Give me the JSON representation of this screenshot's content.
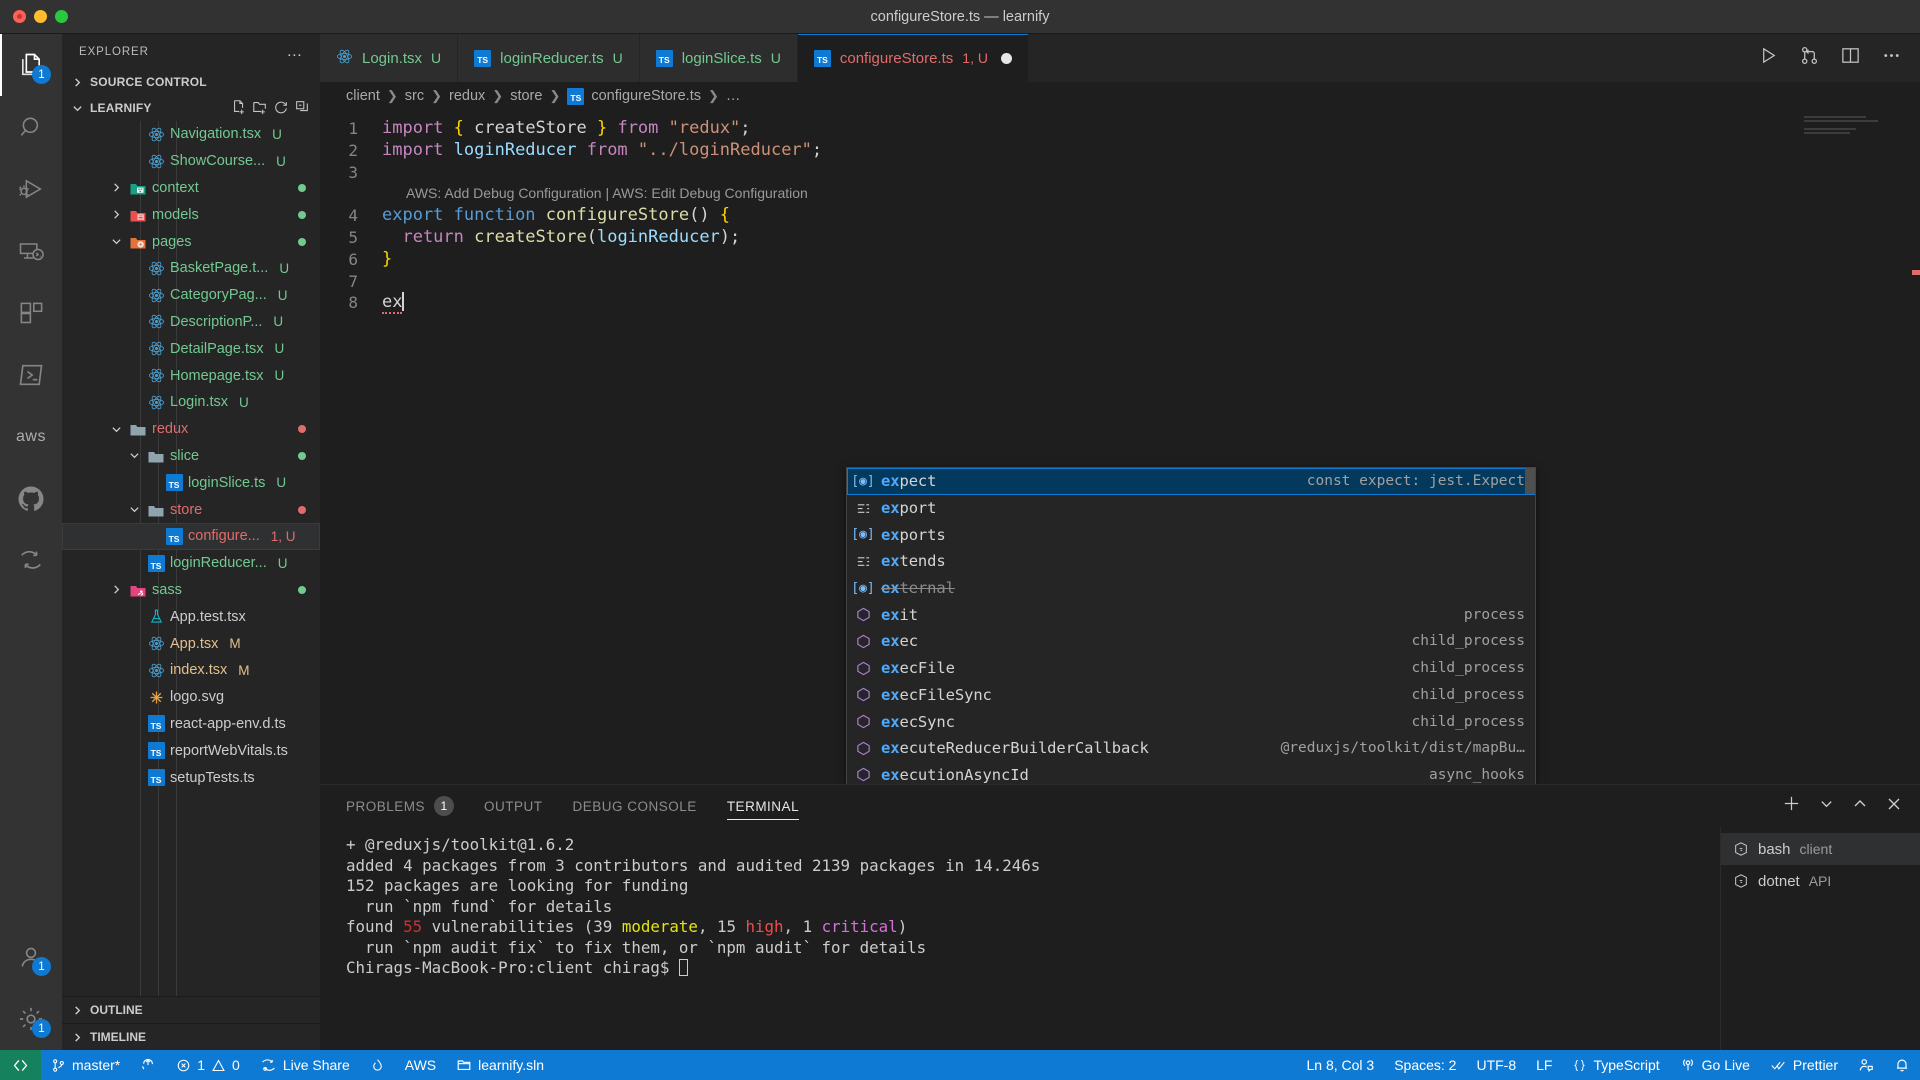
{
  "window": {
    "title": "configureStore.ts — learnify"
  },
  "activity_bar": {
    "items": [
      {
        "name": "explorer",
        "icon": "files-icon",
        "badge": "1",
        "active": true
      },
      {
        "name": "search",
        "icon": "search-icon",
        "badge": "",
        "active": false
      },
      {
        "name": "run-and-debug",
        "icon": "debug-icon",
        "badge": "",
        "active": false
      },
      {
        "name": "remote-explorer",
        "icon": "remote-icon",
        "badge": "",
        "active": false
      },
      {
        "name": "extensions",
        "icon": "extensions-icon",
        "badge": "",
        "active": false
      },
      {
        "name": "powershell",
        "icon": "terminal-icon",
        "badge": "",
        "active": false
      },
      {
        "name": "aws-toolkit",
        "icon": "aws-icon",
        "label": "aws",
        "badge": "",
        "active": false
      },
      {
        "name": "github",
        "icon": "github-icon",
        "badge": "",
        "active": false
      },
      {
        "name": "live-share",
        "icon": "live-share-icon",
        "badge": "",
        "active": false
      }
    ],
    "bottom": [
      {
        "name": "accounts",
        "icon": "account-icon",
        "badge": "1"
      },
      {
        "name": "settings",
        "icon": "gear-icon",
        "badge": "1"
      }
    ]
  },
  "sidebar": {
    "header": "EXPLORER",
    "more_actions": "…",
    "sections": [
      {
        "label": "SOURCE CONTROL",
        "expanded": false
      },
      {
        "label": "LEARNIFY",
        "expanded": true
      }
    ],
    "section_actions": [
      "new-file-icon",
      "new-folder-icon",
      "refresh-icon",
      "collapse-all-icon"
    ],
    "tree": [
      {
        "indent": 3,
        "icon": "react",
        "name": "Navigation.tsx",
        "badge": "U",
        "badge_kind": "u",
        "type": "file"
      },
      {
        "indent": 3,
        "icon": "react",
        "name": "ShowCourse...",
        "badge": "U",
        "badge_kind": "u",
        "type": "file"
      },
      {
        "indent": 2,
        "icon": "folder-context",
        "name": "context",
        "arrow": "right",
        "dot": "#73c991",
        "type": "folder"
      },
      {
        "indent": 2,
        "icon": "folder-models",
        "name": "models",
        "arrow": "right",
        "dot": "#73c991",
        "type": "folder"
      },
      {
        "indent": 2,
        "icon": "folder-pages",
        "name": "pages",
        "arrow": "down",
        "dot": "#73c991",
        "type": "folder"
      },
      {
        "indent": 3,
        "icon": "react",
        "name": "BasketPage.t...",
        "badge": "U",
        "badge_kind": "u",
        "type": "file"
      },
      {
        "indent": 3,
        "icon": "react",
        "name": "CategoryPag...",
        "badge": "U",
        "badge_kind": "u",
        "type": "file"
      },
      {
        "indent": 3,
        "icon": "react",
        "name": "DescriptionP...",
        "badge": "U",
        "badge_kind": "u",
        "type": "file"
      },
      {
        "indent": 3,
        "icon": "react",
        "name": "DetailPage.tsx",
        "badge": "U",
        "badge_kind": "u",
        "type": "file"
      },
      {
        "indent": 3,
        "icon": "react",
        "name": "Homepage.tsx",
        "badge": "U",
        "badge_kind": "u",
        "type": "file"
      },
      {
        "indent": 3,
        "icon": "react",
        "name": "Login.tsx",
        "badge": "U",
        "badge_kind": "u",
        "type": "file"
      },
      {
        "indent": 2,
        "icon": "folder",
        "name": "redux",
        "arrow": "down",
        "dot": "#e06c6c",
        "type": "folder",
        "color": "#e06c6c"
      },
      {
        "indent": 3,
        "icon": "folder",
        "name": "slice",
        "arrow": "down",
        "dot": "#73c991",
        "type": "folder"
      },
      {
        "indent": 4,
        "icon": "ts",
        "name": "loginSlice.ts",
        "badge": "U",
        "badge_kind": "u",
        "type": "file"
      },
      {
        "indent": 3,
        "icon": "folder",
        "name": "store",
        "arrow": "down",
        "dot": "#e06c6c",
        "type": "folder",
        "color": "#e06c6c"
      },
      {
        "indent": 4,
        "icon": "ts",
        "name": "configure...",
        "badge": "1, U",
        "badge_kind": "err",
        "type": "file",
        "color": "#e06c6c",
        "selected": true
      },
      {
        "indent": 3,
        "icon": "ts",
        "name": "loginReducer...",
        "badge": "U",
        "badge_kind": "u",
        "type": "file"
      },
      {
        "indent": 2,
        "icon": "folder-sass",
        "name": "sass",
        "arrow": "right",
        "dot": "#73c991",
        "type": "folder"
      },
      {
        "indent": 3,
        "icon": "test",
        "name": "App.test.tsx",
        "badge": "",
        "type": "file",
        "color": "#cccccc"
      },
      {
        "indent": 3,
        "icon": "react",
        "name": "App.tsx",
        "badge": "M",
        "badge_kind": "m",
        "type": "file",
        "color": "#e2c08d"
      },
      {
        "indent": 3,
        "icon": "react",
        "name": "index.tsx",
        "badge": "M",
        "badge_kind": "m",
        "type": "file",
        "color": "#e2c08d"
      },
      {
        "indent": 3,
        "icon": "svg",
        "name": "logo.svg",
        "badge": "",
        "type": "file",
        "color": "#cccccc"
      },
      {
        "indent": 3,
        "icon": "ts",
        "name": "react-app-env.d.ts",
        "badge": "",
        "type": "file",
        "color": "#cccccc"
      },
      {
        "indent": 3,
        "icon": "ts",
        "name": "reportWebVitals.ts",
        "badge": "",
        "type": "file",
        "color": "#cccccc"
      },
      {
        "indent": 3,
        "icon": "ts",
        "name": "setupTests.ts",
        "badge": "",
        "type": "file",
        "color": "#cccccc"
      }
    ],
    "bottom_sections": [
      {
        "label": "OUTLINE",
        "expanded": false
      },
      {
        "label": "TIMELINE",
        "expanded": false
      }
    ]
  },
  "tabs": [
    {
      "label": "Login.tsx",
      "suffix": "U",
      "icon": "react",
      "active": false,
      "dirty": false
    },
    {
      "label": "loginReducer.ts",
      "suffix": "U",
      "icon": "ts",
      "active": false,
      "dirty": false
    },
    {
      "label": "loginSlice.ts",
      "suffix": "U",
      "icon": "ts",
      "active": false,
      "dirty": false
    },
    {
      "label": "configureStore.ts",
      "suffix": "1, U",
      "icon": "ts",
      "active": true,
      "dirty": true
    }
  ],
  "editor_actions": [
    "run-icon",
    "source-control-icon",
    "split-editor-icon",
    "more-actions-icon"
  ],
  "breadcrumb": {
    "parts": [
      "client",
      "src",
      "redux",
      "store"
    ],
    "file": "configureStore.ts",
    "trailing": "…",
    "file_icon": "ts"
  },
  "code": {
    "lines": [
      {
        "num": "1",
        "tokens": [
          {
            "t": "import ",
            "c": "k-purple"
          },
          {
            "t": "{ ",
            "c": "k-brace-y"
          },
          {
            "t": "createStore",
            "c": "k-plain"
          },
          {
            "t": " }",
            "c": "k-brace-y"
          },
          {
            "t": " from ",
            "c": "k-purple"
          },
          {
            "t": "\"redux\"",
            "c": "k-str"
          },
          {
            "t": ";",
            "c": "k-plain"
          }
        ]
      },
      {
        "num": "2",
        "tokens": [
          {
            "t": "import ",
            "c": "k-purple"
          },
          {
            "t": "loginReducer",
            "c": "k-var"
          },
          {
            "t": " from ",
            "c": "k-purple"
          },
          {
            "t": "\"../loginReducer\"",
            "c": "k-str"
          },
          {
            "t": ";",
            "c": "k-plain"
          }
        ]
      },
      {
        "num": "3",
        "tokens": []
      },
      {
        "num": "4",
        "tokens": [
          {
            "t": "export ",
            "c": "k-blue"
          },
          {
            "t": "function ",
            "c": "k-blue"
          },
          {
            "t": "configureStore",
            "c": "k-fn"
          },
          {
            "t": "()",
            "c": "k-plain"
          },
          {
            "t": " {",
            "c": "k-brace-y"
          }
        ]
      },
      {
        "num": "5",
        "tokens": [
          {
            "t": "  return ",
            "c": "k-purple"
          },
          {
            "t": "createStore",
            "c": "k-fn"
          },
          {
            "t": "(",
            "c": "k-plain"
          },
          {
            "t": "loginReducer",
            "c": "k-var"
          },
          {
            "t": ");",
            "c": "k-plain"
          }
        ]
      },
      {
        "num": "6",
        "tokens": [
          {
            "t": "}",
            "c": "k-brace-y"
          }
        ]
      },
      {
        "num": "7",
        "tokens": []
      },
      {
        "num": "8",
        "tokens": [
          {
            "t": "ex",
            "c": "k-plain"
          }
        ]
      }
    ],
    "codelens": "AWS: Add Debug Configuration | AWS: Edit Debug Configuration",
    "codelens_before_line": "4"
  },
  "suggest": {
    "items": [
      {
        "label_match": "ex",
        "label_rest": "pect",
        "icon": "variable-icon",
        "detail": "const expect: jest.Expect",
        "selected": true,
        "deprecated": false
      },
      {
        "label_match": "ex",
        "label_rest": "port",
        "icon": "keyword-icon",
        "detail": "",
        "selected": false,
        "deprecated": false
      },
      {
        "label_match": "ex",
        "label_rest": "ports",
        "icon": "variable-icon",
        "detail": "",
        "selected": false,
        "deprecated": false
      },
      {
        "label_match": "ex",
        "label_rest": "tends",
        "icon": "keyword-icon",
        "detail": "",
        "selected": false,
        "deprecated": false
      },
      {
        "label_match": "ex",
        "label_rest": "ternal",
        "icon": "variable-icon",
        "detail": "",
        "selected": false,
        "deprecated": true
      },
      {
        "label_match": "ex",
        "label_rest": "it",
        "icon": "module-icon",
        "detail": "process",
        "selected": false,
        "deprecated": false
      },
      {
        "label_match": "ex",
        "label_rest": "ec",
        "icon": "module-icon",
        "detail": "child_process",
        "selected": false,
        "deprecated": false
      },
      {
        "label_match": "ex",
        "label_rest": "ecFile",
        "icon": "module-icon",
        "detail": "child_process",
        "selected": false,
        "deprecated": false
      },
      {
        "label_match": "ex",
        "label_rest": "ecFileSync",
        "icon": "module-icon",
        "detail": "child_process",
        "selected": false,
        "deprecated": false
      },
      {
        "label_match": "ex",
        "label_rest": "ecSync",
        "icon": "module-icon",
        "detail": "child_process",
        "selected": false,
        "deprecated": false
      },
      {
        "label_match": "ex",
        "label_rest": "ecuteReducerBuilderCallback",
        "icon": "module-icon",
        "detail": "@reduxjs/toolkit/dist/mapBu…",
        "selected": false,
        "deprecated": false
      },
      {
        "label_match": "ex",
        "label_rest": "ecutionAsyncId",
        "icon": "module-icon",
        "detail": "async_hooks",
        "selected": false,
        "deprecated": false
      }
    ]
  },
  "panel": {
    "tabs": [
      {
        "label": "PROBLEMS",
        "count": "1",
        "active": false
      },
      {
        "label": "OUTPUT",
        "count": "",
        "active": false
      },
      {
        "label": "DEBUG CONSOLE",
        "count": "",
        "active": false
      },
      {
        "label": "TERMINAL",
        "count": "",
        "active": true
      }
    ],
    "actions": [
      "add-terminal-icon",
      "chevron-down-icon",
      "maximize-panel-icon",
      "close-panel-icon"
    ],
    "terminal_lines": [
      [
        {
          "t": "+ @reduxjs/toolkit@1.6.2",
          "c": ""
        }
      ],
      [
        {
          "t": "added 4 packages from 3 contributors and audited 2139 packages in 14.246s",
          "c": ""
        }
      ],
      [
        {
          "t": "",
          "c": ""
        }
      ],
      [
        {
          "t": "152 packages are looking for funding",
          "c": ""
        }
      ],
      [
        {
          "t": "  run `npm fund` for details",
          "c": ""
        }
      ],
      [
        {
          "t": "",
          "c": ""
        }
      ],
      [
        {
          "t": "found ",
          "c": ""
        },
        {
          "t": "55",
          "c": "t-red"
        },
        {
          "t": " vulnerabilities (39 ",
          "c": ""
        },
        {
          "t": "moderate",
          "c": "t-yellow"
        },
        {
          "t": ", 15 ",
          "c": ""
        },
        {
          "t": "high",
          "c": "t-lightred"
        },
        {
          "t": ", 1 ",
          "c": ""
        },
        {
          "t": "critical",
          "c": "t-magenta"
        },
        {
          "t": ")",
          "c": ""
        }
      ],
      [
        {
          "t": "  run `npm audit fix` to fix them, or `npm audit` for details",
          "c": ""
        }
      ],
      [
        {
          "t": "Chirags-MacBook-Pro:client chirag$ ",
          "c": "",
          "cursor": true
        }
      ]
    ],
    "terminal_list": [
      {
        "name": "bash",
        "sub": "client",
        "icon": "terminal-icon",
        "selected": true
      },
      {
        "name": "dotnet",
        "sub": "API",
        "icon": "terminal-icon",
        "selected": false
      }
    ]
  },
  "status_bar": {
    "remote_icon": "remote-window-icon",
    "left": [
      {
        "label": "master*",
        "icon": "source-control-icon",
        "name": "branch"
      },
      {
        "label": "",
        "icon": "sync-icon",
        "name": "sync"
      },
      {
        "label": "1",
        "icon": "error-icon",
        "label2": "0",
        "icon2": "warning-icon",
        "name": "problems"
      },
      {
        "label": "Live Share",
        "icon": "live-share-icon",
        "name": "live-share"
      },
      {
        "label": "",
        "icon": "flame-icon",
        "name": "flame"
      },
      {
        "label": "AWS",
        "icon": "",
        "name": "aws"
      },
      {
        "label": "learnify.sln",
        "icon": "solution-icon",
        "name": "solution"
      }
    ],
    "right": [
      {
        "label": "Ln 8, Col 3",
        "name": "cursor-position"
      },
      {
        "label": "Spaces: 2",
        "name": "indentation"
      },
      {
        "label": "UTF-8",
        "name": "encoding"
      },
      {
        "label": "LF",
        "name": "eol"
      },
      {
        "label": "TypeScript",
        "icon": "braces-icon",
        "name": "language-mode"
      },
      {
        "label": "Go Live",
        "icon": "broadcast-icon",
        "name": "go-live"
      },
      {
        "label": "Prettier",
        "icon": "check-icon",
        "name": "prettier"
      },
      {
        "label": "",
        "icon": "feedback-icon",
        "name": "feedback"
      },
      {
        "label": "",
        "icon": "bell-icon",
        "name": "notifications"
      }
    ]
  }
}
